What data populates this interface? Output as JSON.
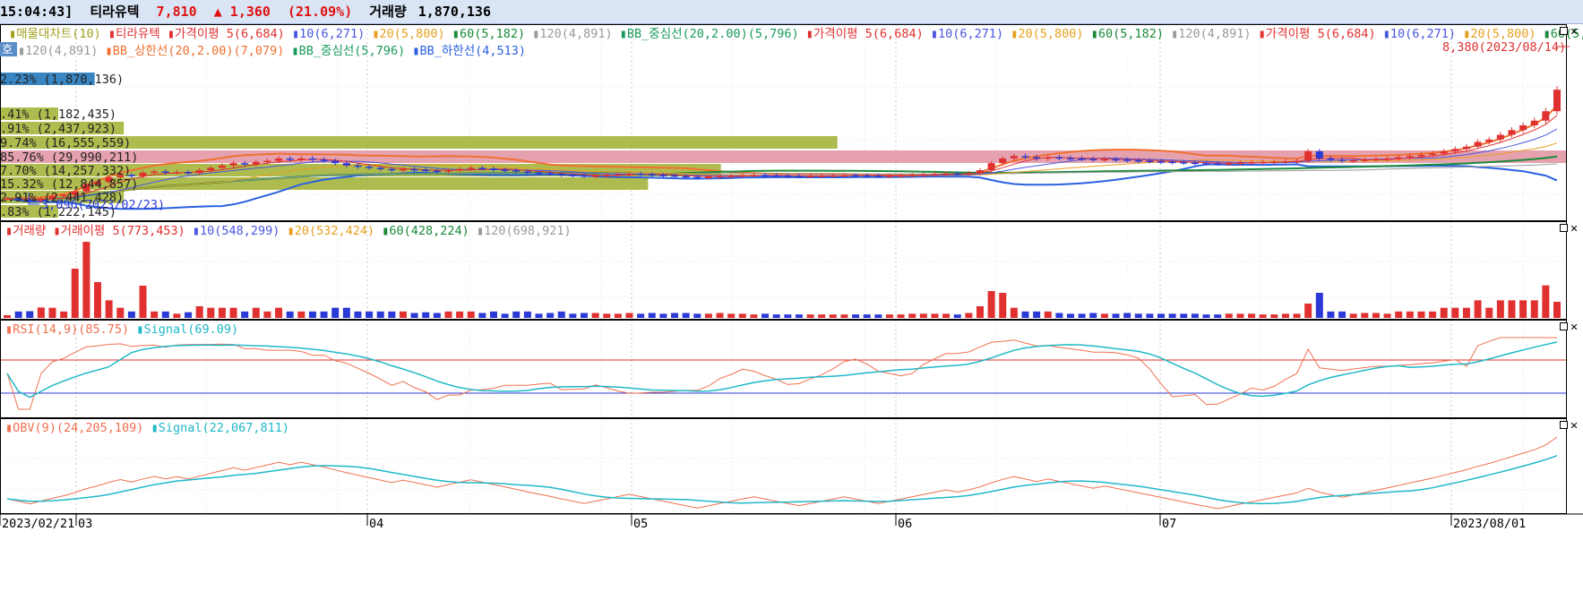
{
  "header": {
    "time": "15:04:43]",
    "name": "티라유텍",
    "price": "7,810",
    "change": "▲ 1,360",
    "change_pct": "(21.09%)",
    "volume_label": "거래량",
    "volume": "1,870,136"
  },
  "colors": {
    "up": "#e03030",
    "down": "#2b39d6",
    "ma5": "#e03030",
    "ma10": "#4a57e0",
    "ma20": "#e8a020",
    "ma60": "#1a8a3a",
    "ma120": "#9a9a9a",
    "bb_upper": "#f07030",
    "bb_mid": "#1a9a5a",
    "bb_lower": "#2a60e0",
    "rsi": "#f07050",
    "signal": "#20b8c8"
  },
  "price_panel": {
    "legend_line1": [
      {
        "text": "매물대차트(10)",
        "color": "#a0a020"
      },
      {
        "text": "티라유텍",
        "color": "#e03030"
      },
      {
        "text": "가격이평 5(6,684)",
        "color": "#e03030"
      },
      {
        "text": "10(6,271)",
        "color": "#4a57e0"
      },
      {
        "text": "20(5,800)",
        "color": "#e8a020"
      },
      {
        "text": "60(5,182)",
        "color": "#1a8a3a"
      },
      {
        "text": "120(4,891)",
        "color": "#9a9a9a"
      },
      {
        "text": "BB_중심선(20,2.00)(5,796)",
        "color": "#1a9a5a"
      },
      {
        "text": "가격이평 5(6,684)",
        "color": "#e03030"
      },
      {
        "text": "10(6,271)",
        "color": "#4a57e0"
      },
      {
        "text": "20(5,800)",
        "color": "#e8a020"
      },
      {
        "text": "60(5,182)",
        "color": "#1a8a3a"
      },
      {
        "text": "120(4,891)",
        "color": "#9a9a9a"
      },
      {
        "text": "가격이평 5(6,684)",
        "color": "#e03030"
      },
      {
        "text": "10(6,271)",
        "color": "#4a57e0"
      },
      {
        "text": "20(5,800)",
        "color": "#e8a020"
      },
      {
        "text": "60(5,18",
        "color": "#1a8a3a"
      }
    ],
    "legend_line2": [
      {
        "text": "120(4,891)",
        "color": "#9a9a9a"
      },
      {
        "text": "BB_상한선(20,2.00)(7,079)",
        "color": "#f07030"
      },
      {
        "text": "BB_중심선(5,796)",
        "color": "#1a9a5a"
      },
      {
        "text": "BB_하한선(4,513)",
        "color": "#2a60e0"
      }
    ],
    "label_box": "호",
    "high_annotation": "8,380(2023/08/14)",
    "low_annotation": "3,096(2023/02/23)",
    "volume_profile": [
      {
        "label": "2.23% (1,870,136)",
        "fraction": 0.013
      },
      {
        "label": ".41% (1,182,435)",
        "fraction": 0.008
      },
      {
        "label": ".91% (2,437,923)",
        "fraction": 0.017
      },
      {
        "label": "9.74% (16,555,559)",
        "fraction": 0.115
      },
      {
        "label": "85.76% (29,990,211)",
        "fraction": 0.209
      },
      {
        "label": "7.70% (14,257,332)",
        "fraction": 0.099
      },
      {
        "label": "15.32% (12,844,857)",
        "fraction": 0.089
      },
      {
        "label": "2.91% (2,441,428)",
        "fraction": 0.017
      },
      {
        "label": ".83% (1,222,145)",
        "fraction": 0.008
      }
    ]
  },
  "volume_panel": {
    "legend": [
      {
        "text": "거래량",
        "color": "#e03030"
      },
      {
        "text": "거래이평 5(773,453)",
        "color": "#e03030"
      },
      {
        "text": "10(548,299)",
        "color": "#4a57e0"
      },
      {
        "text": "20(532,424)",
        "color": "#e8a020"
      },
      {
        "text": "60(428,224)",
        "color": "#1a8a3a"
      },
      {
        "text": "120(698,921)",
        "color": "#9a9a9a"
      }
    ]
  },
  "rsi_panel": {
    "legend": [
      {
        "text": "RSI(14,9)(85.75)",
        "color": "#f07050"
      },
      {
        "text": "Signal(69.09)",
        "color": "#20b8c8"
      }
    ]
  },
  "obv_panel": {
    "legend": [
      {
        "text": "OBV(9)(24,205,109)",
        "color": "#f07050"
      },
      {
        "text": "Signal(22,067,811)",
        "color": "#20b8c8"
      }
    ]
  },
  "x_axis_labels": [
    "2023/02/21",
    "03",
    "04",
    "05",
    "06",
    "07",
    "2023/08/01"
  ],
  "chart_data": {
    "type": "candlestick",
    "title": "티라유텍",
    "x_range": [
      "2023/02/21",
      "2023/08/14"
    ],
    "price_range": [
      3000,
      8500
    ],
    "grid": true,
    "close_series": [
      3200,
      3150,
      3096,
      3200,
      3300,
      3350,
      3500,
      3800,
      3900,
      4100,
      4200,
      4150,
      4300,
      4350,
      4300,
      4320,
      4280,
      4400,
      4500,
      4600,
      4700,
      4650,
      4750,
      4800,
      4900,
      4850,
      4900,
      4850,
      4800,
      4700,
      4600,
      4550,
      4500,
      4450,
      4400,
      4450,
      4420,
      4380,
      4350,
      4400,
      4450,
      4500,
      4470,
      4420,
      4400,
      4350,
      4300,
      4280,
      4250,
      4200,
      4180,
      4150,
      4180,
      4200,
      4220,
      4250,
      4230,
      4200,
      4180,
      4150,
      4120,
      4100,
      4120,
      4150,
      4170,
      4190,
      4200,
      4180,
      4170,
      4160,
      4150,
      4160,
      4170,
      4180,
      4190,
      4180,
      4170,
      4160,
      4170,
      4180,
      4200,
      4220,
      4240,
      4260,
      4250,
      4280,
      4400,
      4700,
      4900,
      5000,
      4950,
      4900,
      4950,
      4920,
      4900,
      4880,
      4850,
      4870,
      4850,
      4820,
      4800,
      4780,
      4760,
      4740,
      4720,
      4700,
      4690,
      4680,
      4700,
      4720,
      4740,
      4750,
      4760,
      4780,
      4800,
      5200,
      4900,
      4850,
      4800,
      4820,
      4850,
      4880,
      4900,
      4950,
      5000,
      5050,
      5100,
      5200,
      5300,
      5400,
      5600,
      5700,
      5900,
      6100,
      6300,
      6500,
      6900,
      7810
    ]
  }
}
